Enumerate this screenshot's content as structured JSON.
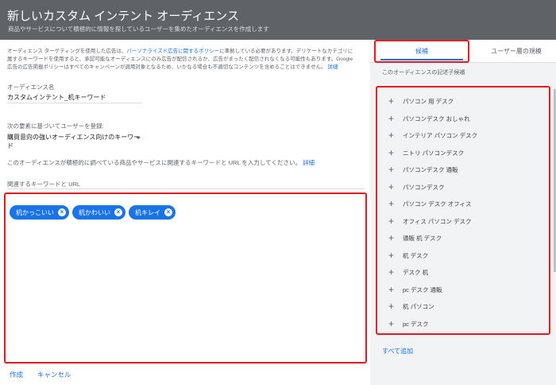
{
  "header": {
    "title": "新しいカスタム インテント オーディエンス",
    "subtitle": "商品やサービスについて積極的に情報を探しているユーザーを集めたオーディエンスを作成します"
  },
  "info": {
    "line1_pre": "オーディエンス ターゲティングを使用した広告は、",
    "policy_link": "パーソナライズド広告に関するポリシー",
    "line1_post": "に準拠している必要があります。デリケートなカテゴリに",
    "line2": "属するキーワードを使用すると、承認可能なオーディエンスにのみ広告が配信されるか、広告がまったく配信されなくなる可能性もあります。Google",
    "line3": "広告の広告掲載ポリシーはすべてのキャンペーンが適用対象となるため、いかなる場合も不適切なコンテンツを含めることはできません。",
    "details_link": "詳細"
  },
  "audience_name": {
    "label": "オーディエンス名",
    "value": "カスタムインテント_机キーワード"
  },
  "register": {
    "label": "次の要素に基づいてユーザーを登録:",
    "selected": "購買意向の強いオーディエンス向けのキーワード"
  },
  "description": {
    "text": "このオーディエンスが積極的に調べている商品やサービスに関連するキーワードと URL を入力してください。",
    "link": "詳細"
  },
  "keywords": {
    "label": "関連するキーワードと URL",
    "chips": [
      "机かっこいい",
      "机かわいい",
      "机キレイ"
    ]
  },
  "actions": {
    "create": "作成",
    "cancel": "キャンセル"
  },
  "sidebar": {
    "tabs": [
      "候補",
      "ユーザー層の規模"
    ],
    "suggestions_label": "このオーディエンスの記述子候補",
    "suggestions": [
      "パソコン 用 デスク",
      "パソコンデスク おしゃれ",
      "インテリア パソコン デスク",
      "ニトリ パソコンデスク",
      "パソコンデスク 通販",
      "パソコンデスク",
      "パソコン デスク オフィス",
      "オフィス パソコン デスク",
      "通販 机 デスク",
      "机 デスク",
      "デスク 机",
      "pc デスク 通販",
      "机 パソコン",
      "pc デスク"
    ],
    "add_all": "すべて追加"
  },
  "colors": {
    "accent": "#1a73e8",
    "header_bg": "#5f6368",
    "highlight": "#e8161d"
  }
}
